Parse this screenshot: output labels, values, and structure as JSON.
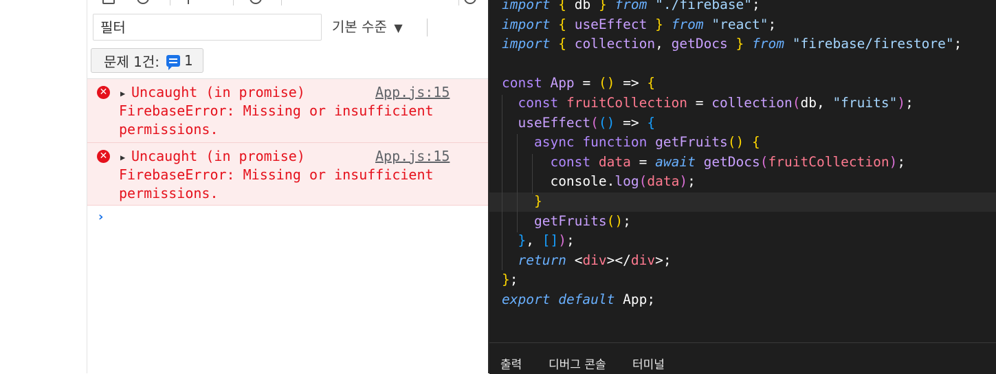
{
  "devtools": {
    "filter": {
      "placeholder": "필터",
      "value": ""
    },
    "levels_label": "기본 수준",
    "levels_arrow": "▼",
    "issues": {
      "label": "문제 1건:",
      "count": "1"
    },
    "messages": [
      {
        "headline": "Uncaught (in promise)",
        "source": "App.js:15",
        "body": "FirebaseError: Missing or insufficient\npermissions."
      },
      {
        "headline": "Uncaught (in promise)",
        "source": "App.js:15",
        "body": "FirebaseError: Missing or insufficient\npermissions."
      }
    ],
    "prompt_symbol": "›"
  },
  "editor": {
    "code": [
      "import { db } from \"./firebase\";",
      "import { useEffect } from \"react\";",
      "import { collection, getDocs } from \"firebase/firestore\";",
      "",
      "const App = () => {",
      "  const fruitCollection = collection(db, \"fruits\");",
      "  useEffect(() => {",
      "    async function getFruits() {",
      "      const data = await getDocs(fruitCollection);",
      "      console.log(data);",
      "    }",
      "    getFruits();",
      "  }, []);",
      "  return <div></div>;",
      "};",
      "export default App;"
    ],
    "panel_tabs": [
      "출력",
      "디버그 콘솔",
      "터미널"
    ]
  },
  "colors": {
    "error_text": "#e5111c",
    "error_bg": "#fdeded",
    "editor_bg": "#1e1e1e",
    "accent_blue": "#1a73e8"
  }
}
